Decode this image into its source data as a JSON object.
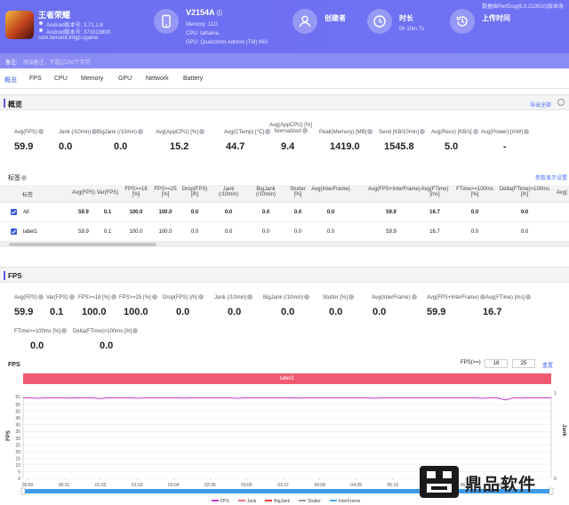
{
  "header": {
    "app_name": "王者荣耀",
    "android_version": "Android版本号: 3.71.1.8",
    "android_code": "Android版本号: 371010800",
    "package": "com.tencent.tmgp.sgame",
    "device_name": "V2154A",
    "memory": "Memory: 11G",
    "cpu": "CPU: taihaina",
    "gpu": "GPU: Qualcomm Adreno (TM) 660",
    "creator_label": "创建者",
    "duration_label": "时长",
    "duration_value": "0h 10m 7s",
    "upload_label": "上传时间",
    "version_text": "数据由PerfDog(6.0.210910)版本收"
  },
  "note": {
    "label": "备注:",
    "value": "添加备注，不超过200个字符"
  },
  "tabs": [
    "概览",
    "FPS",
    "CPU",
    "Memory",
    "GPU",
    "Network",
    "Battery"
  ],
  "overview": {
    "title": "概览",
    "export_link": "导出全部",
    "metrics": [
      {
        "label": "Avg(FPS)",
        "value": "59.9"
      },
      {
        "label": "Jank (/10min)",
        "value": "0.0"
      },
      {
        "label": "BigJank (/10min)",
        "value": "0.0"
      },
      {
        "label": "Avg(AppCPU) [%]",
        "value": "15.2"
      },
      {
        "label": "Avg(CTemp) [°C]",
        "value": "44.7"
      },
      {
        "label": "Avg(AppCPU) [%] Normalized",
        "value": "9.4"
      },
      {
        "label": "Peak(Memory) [MB]",
        "value": "1419.0"
      },
      {
        "label": "Send [KB/10min]",
        "value": "1545.8"
      },
      {
        "label": "Avg(Recv) [KB/s]",
        "value": "5.0"
      },
      {
        "label": "Avg(Power) [mW]",
        "value": "-"
      }
    ]
  },
  "labels_table": {
    "title": "标签",
    "settings_link": "参数显示设置",
    "headers": [
      "标签",
      "Avg(FPS)",
      "Var(FPS)",
      "FPS>=18 [%]",
      "FPS>=25 [%]",
      "Drop(FPS) [/h]",
      "Jank (/10min)",
      "BigJank (/10min)",
      "Stutter [%]",
      "Avg(InterFrame)",
      "Avg(FPS+InterFrame)",
      "Avg(FTime) [ms]",
      "FTime>=100ms [%]",
      "Delta(FTime)>100ms [/h]",
      "Avg("
    ],
    "rows": [
      {
        "cells": [
          "All",
          "59.9",
          "0.1",
          "100.0",
          "100.0",
          "0.0",
          "0.0",
          "0.0",
          "0.0",
          "0.0",
          "59.9",
          "16.7",
          "0.0",
          "0.0",
          ""
        ]
      },
      {
        "cells": [
          "label1",
          "59.9",
          "0.1",
          "100.0",
          "100.0",
          "0.0",
          "0.0",
          "0.0",
          "0.0",
          "0.0",
          "59.9",
          "16.7",
          "0.0",
          "0.0",
          ""
        ]
      }
    ]
  },
  "fps_section": {
    "title": "FPS",
    "metrics_row1": [
      {
        "label": "Avg(FPS)",
        "value": "59.9"
      },
      {
        "label": "Var(FPS)",
        "value": "0.1"
      },
      {
        "label": "FPS>=18 [%]",
        "value": "100.0"
      },
      {
        "label": "FPS>=25 [%]",
        "value": "100.0"
      },
      {
        "label": "Drop(FPS) [/h]",
        "value": "0.0"
      },
      {
        "label": "Jank (/10min)",
        "value": "0.0"
      },
      {
        "label": "BigJank (/10min)",
        "value": "0.0"
      },
      {
        "label": "Stutter [%]",
        "value": "0.0"
      },
      {
        "label": "Avg(InterFrame)",
        "value": "0.0"
      },
      {
        "label": "Avg(FPS+InterFrame)",
        "value": "59.9"
      },
      {
        "label": "Avg(FTime) [ms]",
        "value": "16.7"
      }
    ],
    "metrics_row2": [
      {
        "label": "FTime>=100ms [%]",
        "value": "0.0"
      },
      {
        "label": "Delta(FTime)>100ms [/h]",
        "value": "0.0"
      }
    ],
    "chart_title": "FPS",
    "fps_filter_label": "FPS(>=)",
    "fps_filter_1": "18",
    "fps_filter_2": "25",
    "reset_link": "重置",
    "band_label": "label1",
    "y_axis_label": "FPS",
    "y2_axis_label": "Jank"
  },
  "chart_data": {
    "type": "line",
    "x_ticks": [
      "00:00",
      "00:31",
      "01:02",
      "01:33",
      "02:04",
      "02:35",
      "03:06",
      "03:37",
      "04:08",
      "04:39",
      "05:10",
      "05:41",
      "06:12",
      "06:43"
    ],
    "y_ticks": [
      0,
      5,
      10,
      15,
      20,
      25,
      30,
      35,
      40,
      45,
      50,
      55,
      61
    ],
    "ylim": [
      0,
      61
    ],
    "y2_ticks": [
      0,
      1
    ],
    "ylabel": "FPS",
    "y2label": "Jank",
    "series": [
      {
        "name": "FPS",
        "color": "#c83ad6",
        "values": [
          60,
          60,
          59.6,
          60,
          60,
          60,
          59.8,
          60,
          60,
          60,
          59.5,
          60,
          60,
          60,
          60,
          59.7,
          60,
          60,
          60,
          60,
          60,
          59.8,
          60,
          60,
          60,
          60,
          60,
          60,
          59.6,
          60,
          60,
          60,
          60,
          60,
          60,
          60,
          59.8,
          60,
          60,
          60,
          60,
          60,
          60,
          60,
          60,
          60,
          59.7,
          60,
          60,
          60,
          60,
          60,
          60,
          60,
          60,
          60,
          60,
          60,
          60,
          60,
          59.6,
          60,
          60,
          58.4,
          60,
          59.8,
          60,
          60,
          60,
          60
        ]
      },
      {
        "name": "Jank",
        "color": "#e8707c",
        "values": []
      },
      {
        "name": "BigJank",
        "color": "#e83838",
        "values": []
      },
      {
        "name": "Stutter",
        "color": "#999999",
        "values": []
      },
      {
        "name": "InterFrame",
        "color": "#4aa8e8",
        "values": []
      }
    ]
  },
  "watermark": {
    "text": "鼎品软件"
  }
}
